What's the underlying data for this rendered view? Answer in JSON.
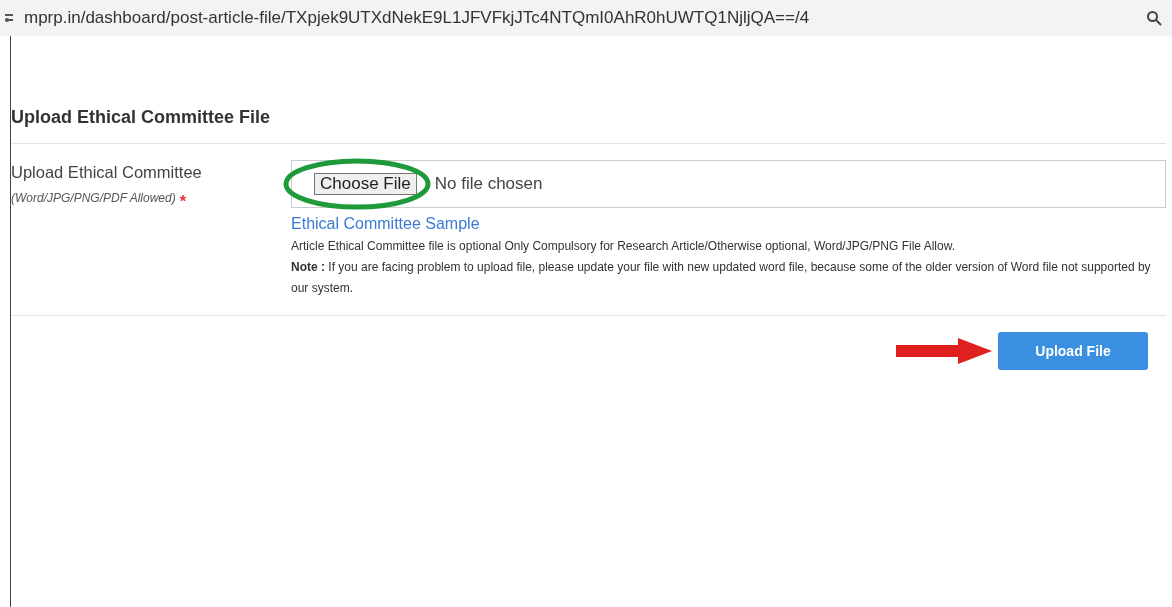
{
  "address_bar": {
    "url": "mprp.in/dashboard/post-article-file/TXpjek9UTXdNekE9L1JFVFkjJTc4NTQmI0AhR0hUWTQ1NjljQA==/4"
  },
  "heading": "Upload Ethical Committee File",
  "upload_field": {
    "label": "Upload Ethical Committee",
    "hint": "(Word/JPG/PNG/PDF Allowed)",
    "required_mark": "*",
    "button": "Choose File",
    "status": "No file chosen"
  },
  "sample_link": "Ethical Committee Sample",
  "description": "Article Ethical Committee file is optional Only Compulsory for Research Article/Otherwise optional, Word/JPG/PNG File Allow.",
  "note": "**Note :** If you are facing problem to upload file, please update your file with new updated word file, because some of the older version of Word file not supported by our system.",
  "submit_button": "Upload File"
}
